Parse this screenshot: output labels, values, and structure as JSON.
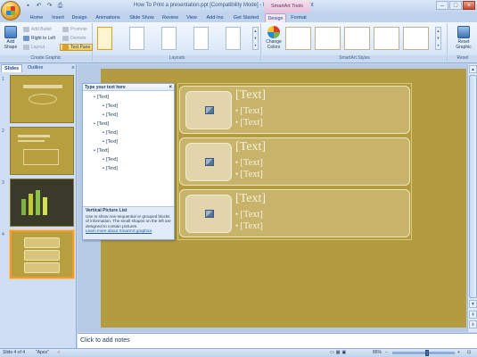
{
  "window": {
    "title": "How To Print a presentation.ppt [Compatibility Mode] - Microsoft PowerPoint",
    "context_group": "SmartArt Tools"
  },
  "qat": [
    "save-icon",
    "undo-icon",
    "redo-icon",
    "print-icon"
  ],
  "tabs": [
    {
      "label": "Home"
    },
    {
      "label": "Insert"
    },
    {
      "label": "Design"
    },
    {
      "label": "Animations"
    },
    {
      "label": "Slide Show"
    },
    {
      "label": "Review"
    },
    {
      "label": "View"
    },
    {
      "label": "Add-Ins"
    },
    {
      "label": "Get Started"
    },
    {
      "label": "Design"
    },
    {
      "label": "Format"
    }
  ],
  "ribbon": {
    "create_graphic": {
      "label": "Create Graphic",
      "add_shape": "Add Shape",
      "add_bullet": "Add Bullet",
      "right_to_left": "Right to Left",
      "layout": "Layout",
      "promote": "Promote",
      "demote": "Demote",
      "text_pane": "Text Pane"
    },
    "layouts": {
      "label": "Layouts"
    },
    "smartart_styles": {
      "label": "SmartArt Styles",
      "change_colors": "Change Colors"
    },
    "reset": {
      "label": "Reset",
      "reset_graphic": "Reset Graphic"
    }
  },
  "left_pane": {
    "tabs": [
      "Slides",
      "Outline"
    ],
    "slides": [
      {
        "num": "1"
      },
      {
        "num": "2"
      },
      {
        "num": "3"
      },
      {
        "num": "4"
      }
    ]
  },
  "text_pane": {
    "header": "Type your text here",
    "items": [
      "[Text]",
      "[Text]",
      "[Text]",
      "[Text]",
      "[Text]",
      "[Text]",
      "[Text]",
      "[Text]",
      "[Text]"
    ],
    "desc_title": "Vertical Picture List",
    "desc_body": "Use to show non-sequential or grouped blocks of information. The small shapes on the left are designed to contain pictures.",
    "desc_link": "Learn more about SmartArt graphics"
  },
  "smartart": {
    "rows": [
      {
        "title": "[Text]",
        "sub1": "[Text]",
        "sub2": "[Text]"
      },
      {
        "title": "[Text]",
        "sub1": "[Text]",
        "sub2": "[Text]"
      },
      {
        "title": "[Text]",
        "sub1": "[Text]",
        "sub2": "[Text]"
      }
    ]
  },
  "notes": {
    "placeholder": "Click to add notes"
  },
  "status": {
    "slide": "Slide 4 of 4",
    "theme": "\"Apex\"",
    "zoom": "86%",
    "zoom_level": 0.55
  }
}
